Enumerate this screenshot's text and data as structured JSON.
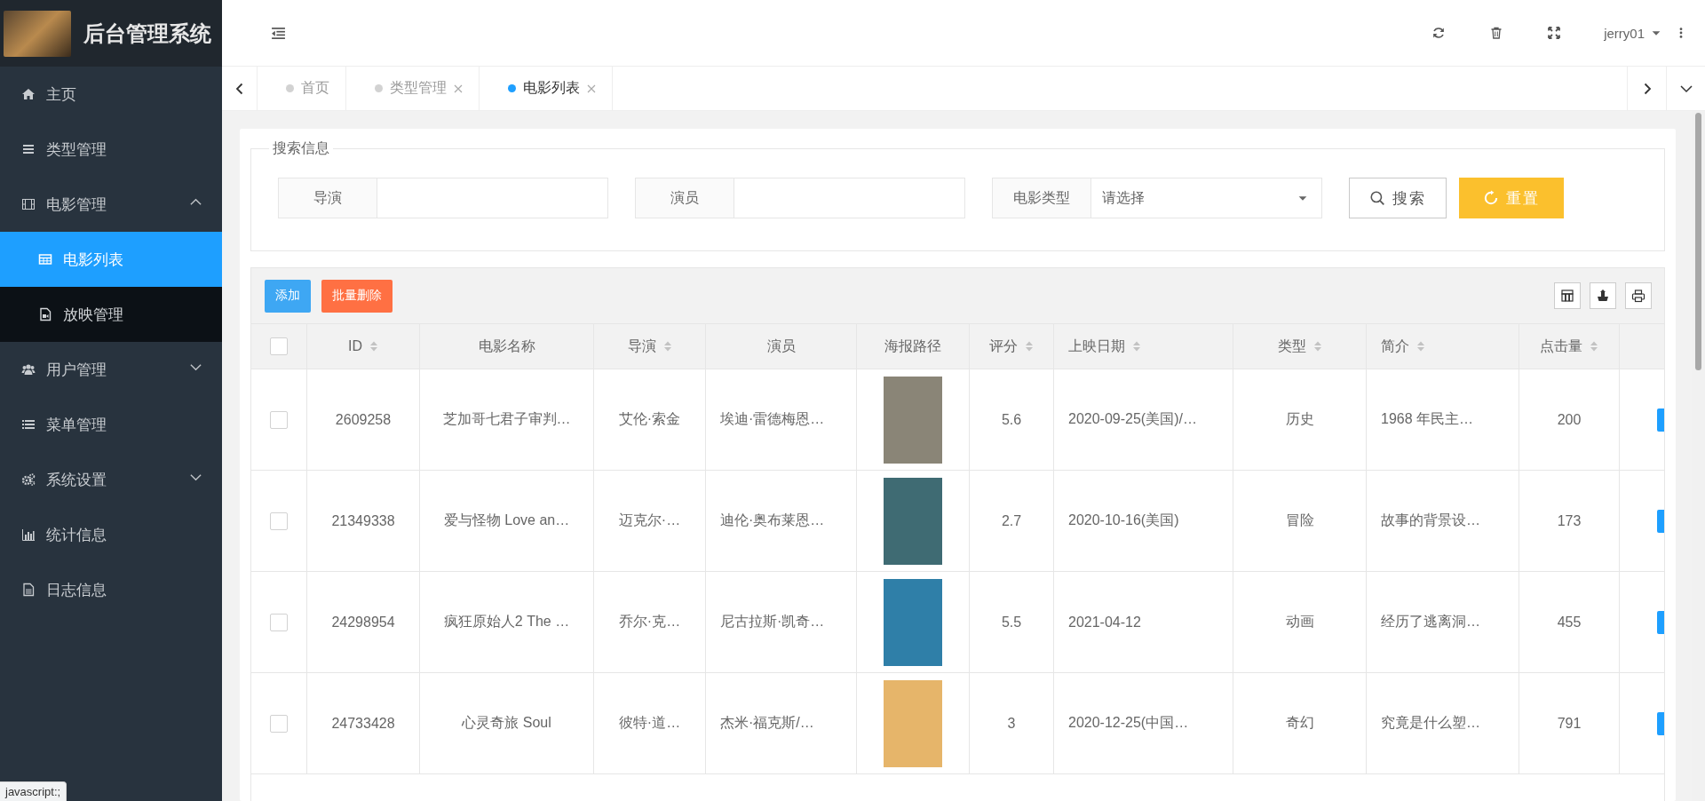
{
  "sidebar": {
    "title": "后台管理系统",
    "items": [
      {
        "kind": "link",
        "label": "主页",
        "selected": false
      },
      {
        "kind": "link",
        "label": "类型管理",
        "selected": false
      },
      {
        "kind": "group",
        "label": "电影管理",
        "selected": false,
        "expanded": true,
        "children": [
          {
            "label": "电影列表",
            "selected": true
          },
          {
            "label": "放映管理",
            "selected": false
          }
        ]
      },
      {
        "kind": "group",
        "label": "用户管理",
        "selected": false,
        "expanded": false
      },
      {
        "kind": "link",
        "label": "菜单管理",
        "selected": false
      },
      {
        "kind": "group",
        "label": "系统设置",
        "selected": false,
        "expanded": false
      },
      {
        "kind": "link",
        "label": "统计信息",
        "selected": false
      },
      {
        "kind": "link",
        "label": "日志信息",
        "selected": false
      }
    ]
  },
  "header": {
    "user": "jerry01"
  },
  "tabs": [
    {
      "label": "首页",
      "selected": false,
      "closable": false
    },
    {
      "label": "类型管理",
      "selected": false,
      "closable": true
    },
    {
      "label": "电影列表",
      "selected": true,
      "closable": true
    }
  ],
  "search": {
    "legend": "搜索信息",
    "fields": [
      {
        "kind": "text",
        "label": "导演"
      },
      {
        "kind": "text",
        "label": "演员"
      },
      {
        "kind": "select",
        "label": "电影类型",
        "placeholder": "请选择"
      }
    ],
    "buttons": [
      {
        "kind": "search",
        "label": "搜索"
      },
      {
        "kind": "reset",
        "label": "重置"
      }
    ]
  },
  "toolbar": {
    "buttons": [
      {
        "kind": "add",
        "label": "添加"
      },
      {
        "kind": "delete",
        "label": "批量删除"
      }
    ]
  },
  "table": {
    "all_checked": false,
    "columns": [
      {
        "label": "ID",
        "sortable": true
      },
      {
        "label": "电影名称",
        "sortable": false
      },
      {
        "label": "导演",
        "sortable": true
      },
      {
        "label": "演员",
        "sortable": false
      },
      {
        "label": "海报路径",
        "sortable": false
      },
      {
        "label": "评分",
        "sortable": true
      },
      {
        "label": "上映日期",
        "sortable": true
      },
      {
        "label": "类型",
        "sortable": true
      },
      {
        "label": "简介",
        "sortable": true
      },
      {
        "label": "点击量",
        "sortable": true
      }
    ],
    "rows": [
      {
        "checked": false,
        "cells": [
          {
            "kind": "text",
            "text": "2609258"
          },
          {
            "kind": "text",
            "text": "芝加哥七君子审判…"
          },
          {
            "kind": "text",
            "text": "艾伦·索金"
          },
          {
            "kind": "text",
            "text": "埃迪·雷德梅恩…"
          },
          {
            "kind": "poster"
          },
          {
            "kind": "text",
            "text": "5.6"
          },
          {
            "kind": "text",
            "text": "2020-09-25(美国)/…"
          },
          {
            "kind": "text",
            "text": "历史"
          },
          {
            "kind": "text",
            "text": "1968 年民主…"
          },
          {
            "kind": "text",
            "text": "200"
          }
        ]
      },
      {
        "checked": false,
        "cells": [
          {
            "kind": "text",
            "text": "21349338"
          },
          {
            "kind": "text",
            "text": "爱与怪物 Love an…"
          },
          {
            "kind": "text",
            "text": "迈克尔·…"
          },
          {
            "kind": "text",
            "text": "迪伦·奥布莱恩…"
          },
          {
            "kind": "poster"
          },
          {
            "kind": "text",
            "text": "2.7"
          },
          {
            "kind": "text",
            "text": "2020-10-16(美国)"
          },
          {
            "kind": "text",
            "text": "冒险"
          },
          {
            "kind": "text",
            "text": "故事的背景设…"
          },
          {
            "kind": "text",
            "text": "173"
          }
        ]
      },
      {
        "checked": false,
        "cells": [
          {
            "kind": "text",
            "text": "24298954"
          },
          {
            "kind": "text",
            "text": "疯狂原始人2 The …"
          },
          {
            "kind": "text",
            "text": "乔尔·克…"
          },
          {
            "kind": "text",
            "text": "尼古拉斯·凯奇…"
          },
          {
            "kind": "poster"
          },
          {
            "kind": "text",
            "text": "5.5"
          },
          {
            "kind": "text",
            "text": "2021-04-12"
          },
          {
            "kind": "text",
            "text": "动画"
          },
          {
            "kind": "text",
            "text": "经历了逃离洞…"
          },
          {
            "kind": "text",
            "text": "455"
          }
        ]
      },
      {
        "checked": false,
        "cells": [
          {
            "kind": "text",
            "text": "24733428"
          },
          {
            "kind": "text",
            "text": "心灵奇旅 Soul"
          },
          {
            "kind": "text",
            "text": "彼特·道…"
          },
          {
            "kind": "text",
            "text": "杰米·福克斯/…"
          },
          {
            "kind": "poster"
          },
          {
            "kind": "text",
            "text": "3"
          },
          {
            "kind": "text",
            "text": "2020-12-25(中国…"
          },
          {
            "kind": "text",
            "text": "奇幻"
          },
          {
            "kind": "text",
            "text": "究竟是什么塑…"
          },
          {
            "kind": "text",
            "text": "791"
          }
        ]
      }
    ]
  },
  "status_text": "javascript:;"
}
